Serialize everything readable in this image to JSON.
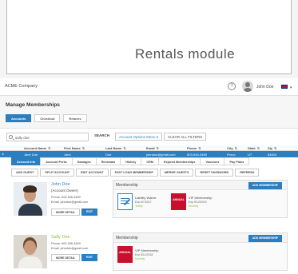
{
  "banner": {
    "title": "Rentals module"
  },
  "header": {
    "company": "ACME Company",
    "help_glyph": "?",
    "user_name": "John Doe",
    "caret": "▾"
  },
  "page": {
    "title": "Manage Memberships",
    "tabs": [
      {
        "label": "Accounts",
        "active": true
      },
      {
        "label": "Checkout",
        "active": false
      },
      {
        "label": "Returns",
        "active": false
      }
    ]
  },
  "search": {
    "value": "sally doe",
    "search_label": "SEARCH",
    "options_label": "Account Options Menu ▾",
    "clear_label": "CLEAR ALL FILTERS"
  },
  "grid": {
    "columns": [
      "Account Name",
      "First Name",
      "Last Name",
      "Email",
      "Phone",
      "City",
      "State",
      "Zip"
    ],
    "sort_glyph": "⇅",
    "row": {
      "expander": "▸",
      "cells": [
        "Jane Doe",
        "John",
        "Doe",
        "johndoe@gmail.com",
        "603-546-3469",
        "Provo",
        "UT",
        "84604"
      ]
    }
  },
  "sub_tabs": [
    {
      "label": "Account Info",
      "active": true
    },
    {
      "label": "Account Perks",
      "active": false
    },
    {
      "label": "Damages",
      "active": false
    },
    {
      "label": "Renewals",
      "active": false
    },
    {
      "label": "History",
      "active": false
    },
    {
      "label": "CRM",
      "active": false
    },
    {
      "label": "Expired Memberships",
      "active": false
    },
    {
      "label": "Vouchers",
      "active": false
    },
    {
      "label": "Pay Plans",
      "active": false
    }
  ],
  "actions": [
    "ADD GUEST",
    "SPLIT ACCOUNT",
    "EDIT ACCOUNT",
    "FAST LOAD MEMBERSHIP",
    "MERGE GUESTS",
    "RESET PASSWORD",
    "REFRESH"
  ],
  "members": [
    {
      "name": "John Doe",
      "role": "(Account Owner)",
      "phone": "Phone: 603-546-3469",
      "email": "Email: johndoe@gmail.com",
      "more_label": "MORE DETAIL",
      "edit_label": "EDIT",
      "membership_label": "Membership",
      "add_label": "ADD MEMBERSHIP",
      "memberships": [
        {
          "title": "Liability Waiver",
          "expires": "Exp 6/7/2017",
          "frequency": "Yearly",
          "icon": "waiver-document-icon"
        },
        {
          "title": "VIP Membership",
          "expires": "Exp 5/12/2019",
          "frequency": "Monthly",
          "icon": "annual-pass-icon",
          "badge": "ANNUAL"
        }
      ]
    },
    {
      "name": "Sally Doe",
      "phone": "Phone: 603-546-3469",
      "email": "Email: johndoe@gmail.com",
      "more_label": "MORE DETAIL",
      "edit_label": "EDIT",
      "membership_label": "Membership",
      "add_label": "ADD MEMBERSHIP",
      "memberships": [
        {
          "title": "VIP Membership",
          "expires": "Exp 5/11/2018",
          "frequency": "Monthly",
          "icon": "annual-pass-icon",
          "badge": "ANNUAL"
        }
      ]
    }
  ],
  "colors": {
    "accent": "#2b7fc0",
    "green": "#8bbf3a",
    "badge_red": "#c8102e"
  }
}
